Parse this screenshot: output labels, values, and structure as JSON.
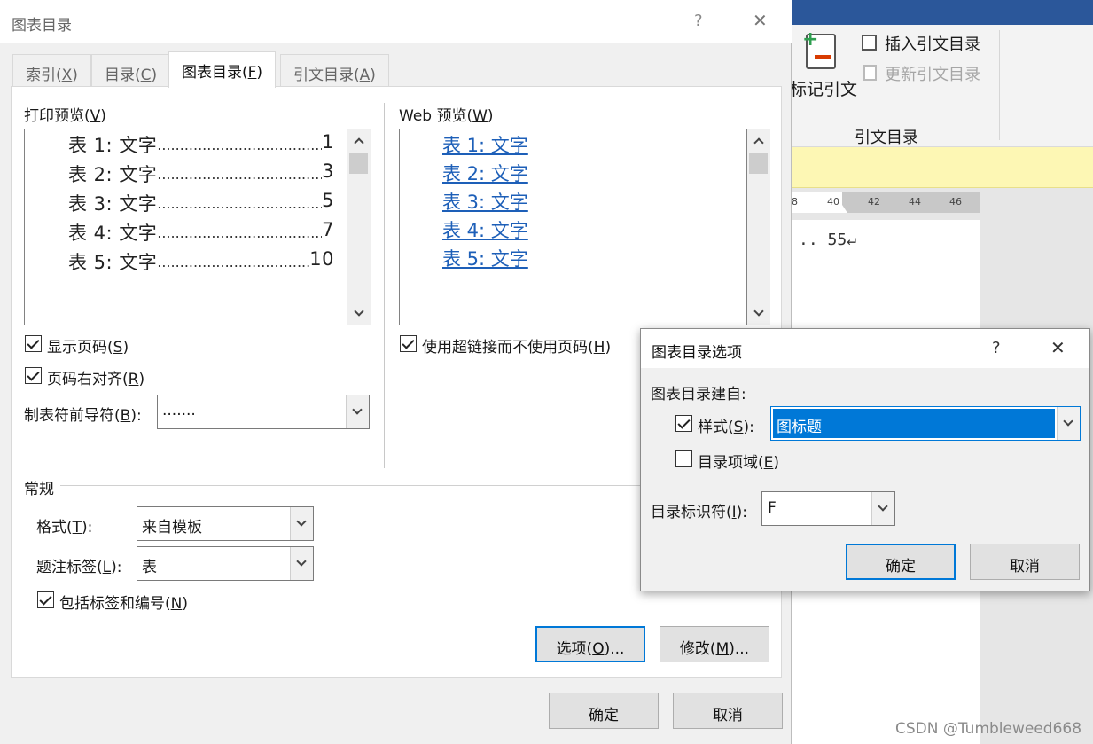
{
  "word_bg": {
    "ribbon_btn_mark_citation": "标记引文",
    "ribbon_insert_toa": "插入引文目录",
    "ribbon_update_toa": "更新引文目录",
    "ribbon_group_label": "引文目录",
    "ruler_labels": [
      "8",
      "40",
      "42",
      "44",
      "46"
    ],
    "doc_text": ".. 55↵",
    "watermark": "CSDN @Tumbleweed668"
  },
  "main_dialog": {
    "title": "图表目录",
    "help": "?",
    "close": "✕",
    "tabs": [
      {
        "label": "索引(",
        "key": "X",
        "tail": ")"
      },
      {
        "label": "目录(",
        "key": "C",
        "tail": ")"
      },
      {
        "label": "图表目录(",
        "key": "F",
        "tail": ")"
      },
      {
        "label": "引文目录(",
        "key": "A",
        "tail": ")"
      }
    ],
    "print_preview_label": "打印预览(",
    "print_preview_key": "V",
    "print_rows": [
      {
        "label": "表  1:  文字",
        "page": "1"
      },
      {
        "label": "表  2:  文字",
        "page": "3"
      },
      {
        "label": "表  3:  文字",
        "page": "5"
      },
      {
        "label": "表  4:  文字",
        "page": "7"
      },
      {
        "label": "表  5:  文字",
        "page": "10"
      }
    ],
    "web_preview_label": "Web 预览(",
    "web_preview_key": "W",
    "web_rows": [
      "表  1:  文字",
      "表  2:  文字",
      "表  3:  文字",
      "表  4:  文字",
      "表  5:  文字"
    ],
    "show_page_numbers": {
      "label": "显示页码(",
      "key": "S",
      "checked": true
    },
    "right_align": {
      "label": "页码右对齐(",
      "key": "R",
      "checked": true
    },
    "use_hyperlinks": {
      "label": "使用超链接而不使用页码(",
      "key": "H",
      "checked": true
    },
    "tab_leader_label": "制表符前导符(",
    "tab_leader_key": "B",
    "tab_leader_value": ".......",
    "general_label": "常规",
    "format_label": "格式(",
    "format_key": "T",
    "format_value": "来自模板",
    "caption_label": "题注标签(",
    "caption_key": "L",
    "caption_value": "表",
    "include_label": {
      "label": "包括标签和编号(",
      "key": "N",
      "checked": true
    },
    "options_btn": "选项(",
    "options_key": "O",
    "modify_btn": "修改(",
    "modify_key": "M",
    "ok": "确定",
    "cancel": "取消"
  },
  "options_dialog": {
    "title": "图表目录选项",
    "help": "?",
    "close": "✕",
    "build_from": "图表目录建自:",
    "style": {
      "label": "样式(",
      "key": "S",
      "checked": true,
      "value": "图标题"
    },
    "toc_fields": {
      "label": "目录项域(",
      "key": "E",
      "checked": false
    },
    "identifier_label": "目录标识符(",
    "identifier_key": "I",
    "identifier_value": "F",
    "ok": "确定",
    "cancel": "取消"
  }
}
